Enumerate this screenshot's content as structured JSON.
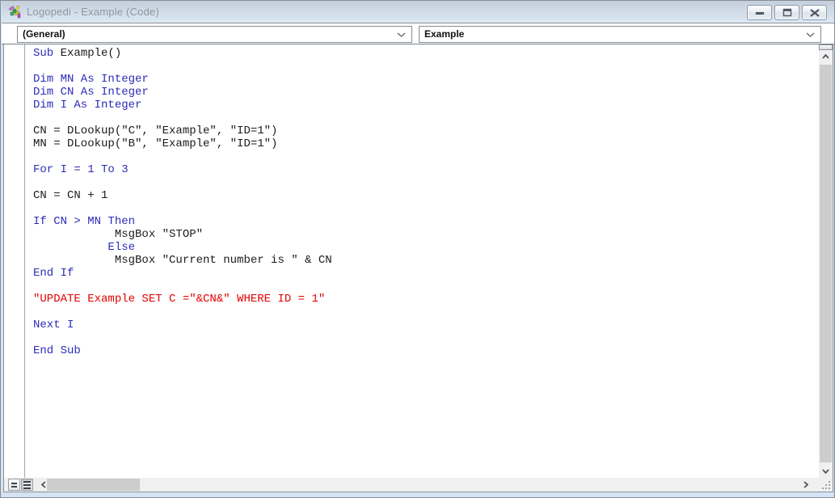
{
  "window": {
    "title": "Logopedi - Example (Code)",
    "buttons": {
      "minimize": "minimize",
      "restore": "restore",
      "close": "close"
    }
  },
  "dropdowns": {
    "object": "(General)",
    "procedure": "Example"
  },
  "colors": {
    "keyword": "#2d2db8",
    "text": "#1b1b1b",
    "error": "#e10000",
    "title_text": "#8f969d"
  },
  "code": {
    "lines": [
      [
        {
          "k": "kw",
          "t": "Sub "
        },
        {
          "k": "tx",
          "t": "Example()"
        }
      ],
      [],
      [
        {
          "k": "kw",
          "t": "Dim MN As Integer"
        }
      ],
      [
        {
          "k": "kw",
          "t": "Dim CN As Integer"
        }
      ],
      [
        {
          "k": "kw",
          "t": "Dim I As Integer"
        }
      ],
      [],
      [
        {
          "k": "tx",
          "t": "CN = DLookup(\"C\", \"Example\", \"ID=1\")"
        }
      ],
      [
        {
          "k": "tx",
          "t": "MN = DLookup(\"B\", \"Example\", \"ID=1\")"
        }
      ],
      [],
      [
        {
          "k": "kw",
          "t": "For I = 1 To 3"
        }
      ],
      [],
      [
        {
          "k": "tx",
          "t": "CN = CN + 1"
        }
      ],
      [],
      [
        {
          "k": "kw",
          "t": "If CN > MN Then"
        }
      ],
      [
        {
          "k": "tx",
          "t": "            MsgBox \"STOP\""
        }
      ],
      [
        {
          "k": "kw",
          "t": "           Else"
        }
      ],
      [
        {
          "k": "tx",
          "t": "            MsgBox \"Current number is \" & CN"
        }
      ],
      [
        {
          "k": "kw",
          "t": "End If"
        }
      ],
      [],
      [
        {
          "k": "er",
          "t": "\"UPDATE Example SET C =\"&CN&\" WHERE ID = 1\""
        }
      ],
      [],
      [
        {
          "k": "kw",
          "t": "Next I"
        }
      ],
      [],
      [
        {
          "k": "kw",
          "t": "End Sub"
        }
      ]
    ]
  }
}
